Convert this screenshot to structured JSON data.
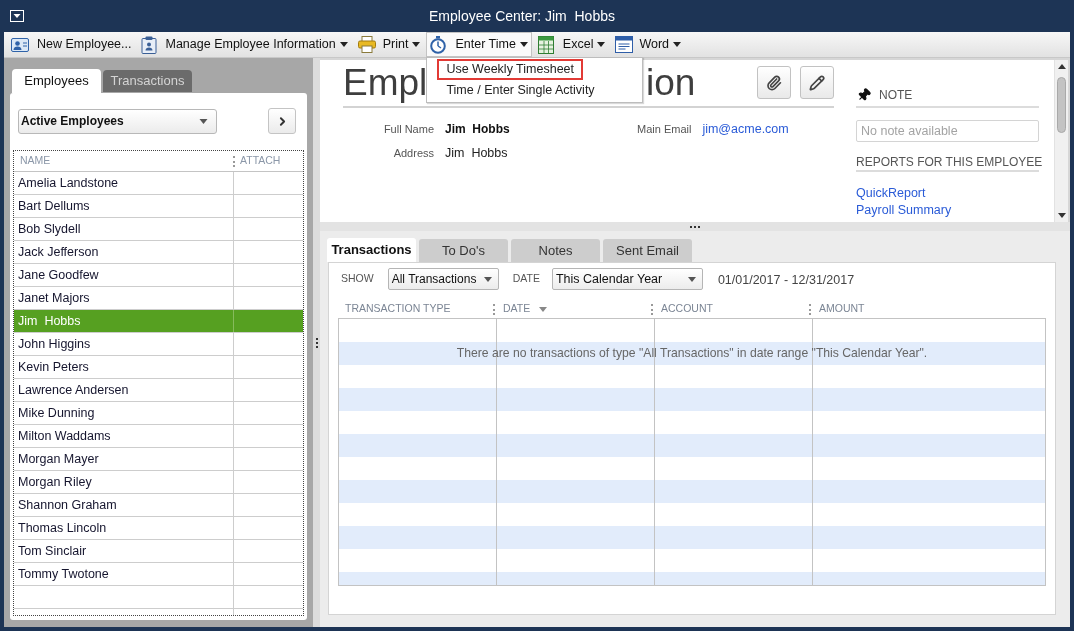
{
  "window": {
    "title": "Employee Center: Jim  Hobbs"
  },
  "toolbar": [
    {
      "label": "New Employee...",
      "dropdown": false,
      "expanded": false
    },
    {
      "label": "Manage Employee Information",
      "dropdown": true,
      "expanded": false
    },
    {
      "label": "Print",
      "dropdown": true,
      "expanded": false
    },
    {
      "label": "Enter Time",
      "dropdown": true,
      "expanded": true,
      "menu": [
        {
          "label": "Use Weekly Timesheet",
          "highlighted": true
        },
        {
          "label": "Time / Enter Single Activity",
          "highlighted": false
        }
      ]
    },
    {
      "label": "Excel",
      "dropdown": true,
      "expanded": false
    },
    {
      "label": "Word",
      "dropdown": true,
      "expanded": false
    }
  ],
  "employees_panel": {
    "tabs": [
      {
        "label": "Employees",
        "selected": true
      },
      {
        "label": "Transactions",
        "selected": false
      }
    ],
    "filter": {
      "value": "Active Employees"
    },
    "list": {
      "columns": [
        "NAME",
        "ATTACH"
      ],
      "rows": [
        {
          "name": "Amelia Landstone",
          "selected": false
        },
        {
          "name": "Bart Dellums",
          "selected": false
        },
        {
          "name": "Bob Slydell",
          "selected": false
        },
        {
          "name": "Jack Jefferson",
          "selected": false
        },
        {
          "name": "Jane Goodfew",
          "selected": false
        },
        {
          "name": "Janet Majors",
          "selected": false
        },
        {
          "name": "Jim  Hobbs",
          "selected": true
        },
        {
          "name": "John Higgins",
          "selected": false
        },
        {
          "name": "Kevin Peters",
          "selected": false
        },
        {
          "name": "Lawrence Andersen",
          "selected": false
        },
        {
          "name": "Mike Dunning",
          "selected": false
        },
        {
          "name": "Milton Waddams",
          "selected": false
        },
        {
          "name": "Morgan Mayer",
          "selected": false
        },
        {
          "name": "Morgan Riley",
          "selected": false
        },
        {
          "name": "Shannon Graham",
          "selected": false
        },
        {
          "name": "Thomas Lincoln",
          "selected": false
        },
        {
          "name": "Tom Sinclair",
          "selected": false
        },
        {
          "name": "Tommy Twotone",
          "selected": false
        }
      ]
    }
  },
  "employee_info": {
    "title_fragments": [
      "Empl",
      "ion"
    ],
    "field_columns": [
      [
        {
          "label": "Full Name",
          "value": "Jim  Hobbs",
          "kind": "bold"
        },
        {
          "label": "Address",
          "value": "Jim  Hobbs",
          "kind": "plain"
        }
      ],
      [
        {
          "label": "Main Email",
          "value": "jim@acme.com",
          "kind": "link"
        }
      ]
    ]
  },
  "note": {
    "heading": "NOTE",
    "placeholder": "No note available"
  },
  "reports": {
    "heading": "REPORTS FOR THIS EMPLOYEE",
    "links": [
      "QuickReport",
      "Payroll Summary"
    ]
  },
  "detail_tabs": [
    {
      "label": "Transactions",
      "selected": true
    },
    {
      "label": "To Do's",
      "selected": false
    },
    {
      "label": "Notes",
      "selected": false
    },
    {
      "label": "Sent Email",
      "selected": false
    }
  ],
  "filters": {
    "show": {
      "label": "SHOW",
      "value": "All Transactions"
    },
    "date": {
      "label": "DATE",
      "value": "This Calendar Year"
    },
    "date_range": "01/01/2017 - 12/31/2017"
  },
  "transactions_table": {
    "columns": [
      {
        "label": "TRANSACTION TYPE",
        "sorted": false
      },
      {
        "label": "DATE",
        "sorted": true
      },
      {
        "label": "ACCOUNT",
        "sorted": false
      },
      {
        "label": "AMOUNT",
        "sorted": false
      }
    ],
    "empty_message": "There are no transactions of type \"All Transactions\" in date range \"This Calendar Year\"."
  }
}
